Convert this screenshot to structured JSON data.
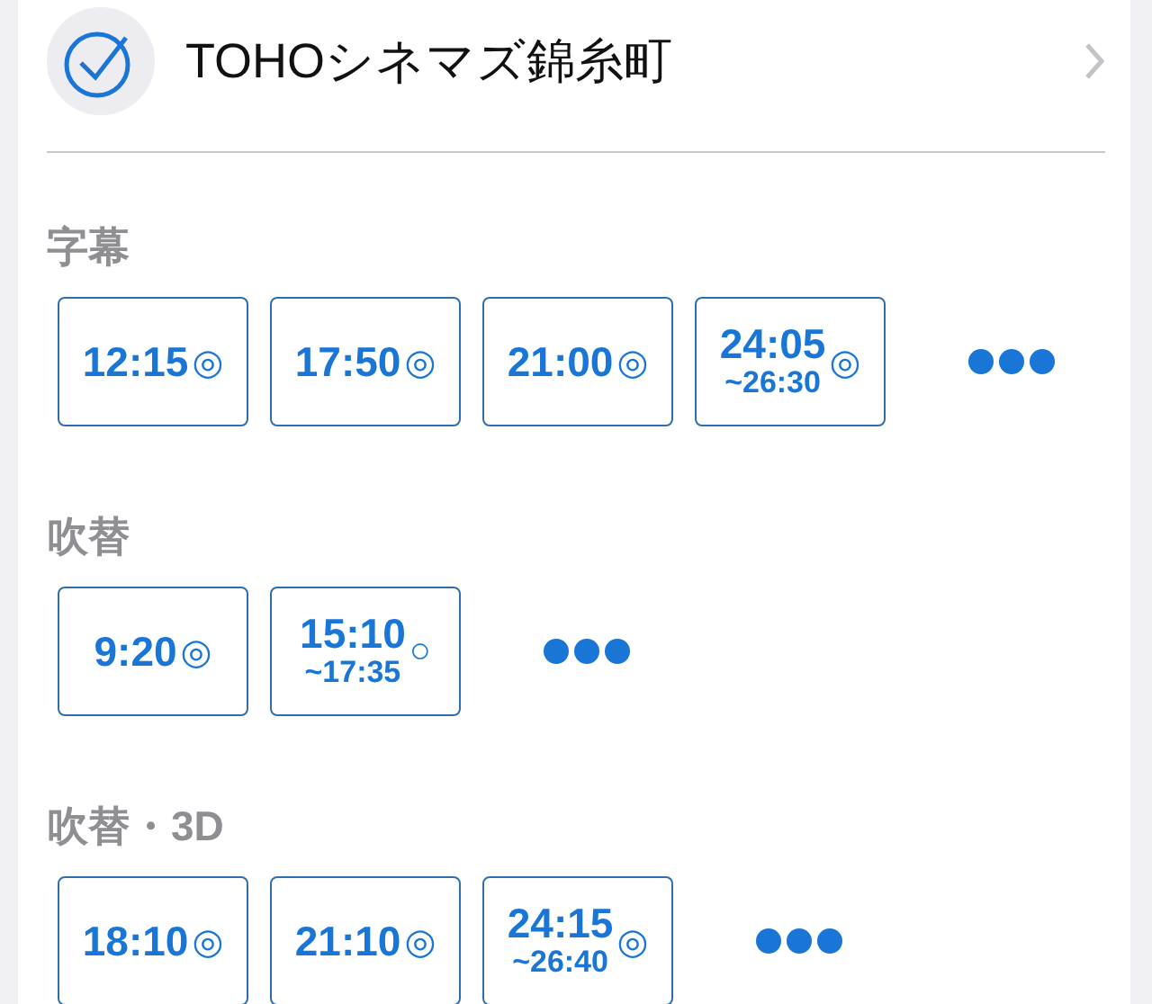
{
  "theater": {
    "name": "TOHOシネマズ錦糸町"
  },
  "sections": [
    {
      "label": "字幕",
      "showtimes": [
        {
          "start": "12:15",
          "mark": "◎"
        },
        {
          "start": "17:50",
          "mark": "◎"
        },
        {
          "start": "21:00",
          "mark": "◎"
        },
        {
          "start": "24:05",
          "end": "~26:30",
          "mark": "◎"
        }
      ]
    },
    {
      "label": "吹替",
      "showtimes": [
        {
          "start": "9:20",
          "mark": "◎"
        },
        {
          "start": "15:10",
          "end": "~17:35",
          "mark": "○"
        }
      ]
    },
    {
      "label": "吹替・3D",
      "showtimes": [
        {
          "start": "18:10",
          "mark": "◎"
        },
        {
          "start": "21:10",
          "mark": "◎"
        },
        {
          "start": "24:15",
          "end": "~26:40",
          "mark": "◎"
        }
      ]
    }
  ]
}
